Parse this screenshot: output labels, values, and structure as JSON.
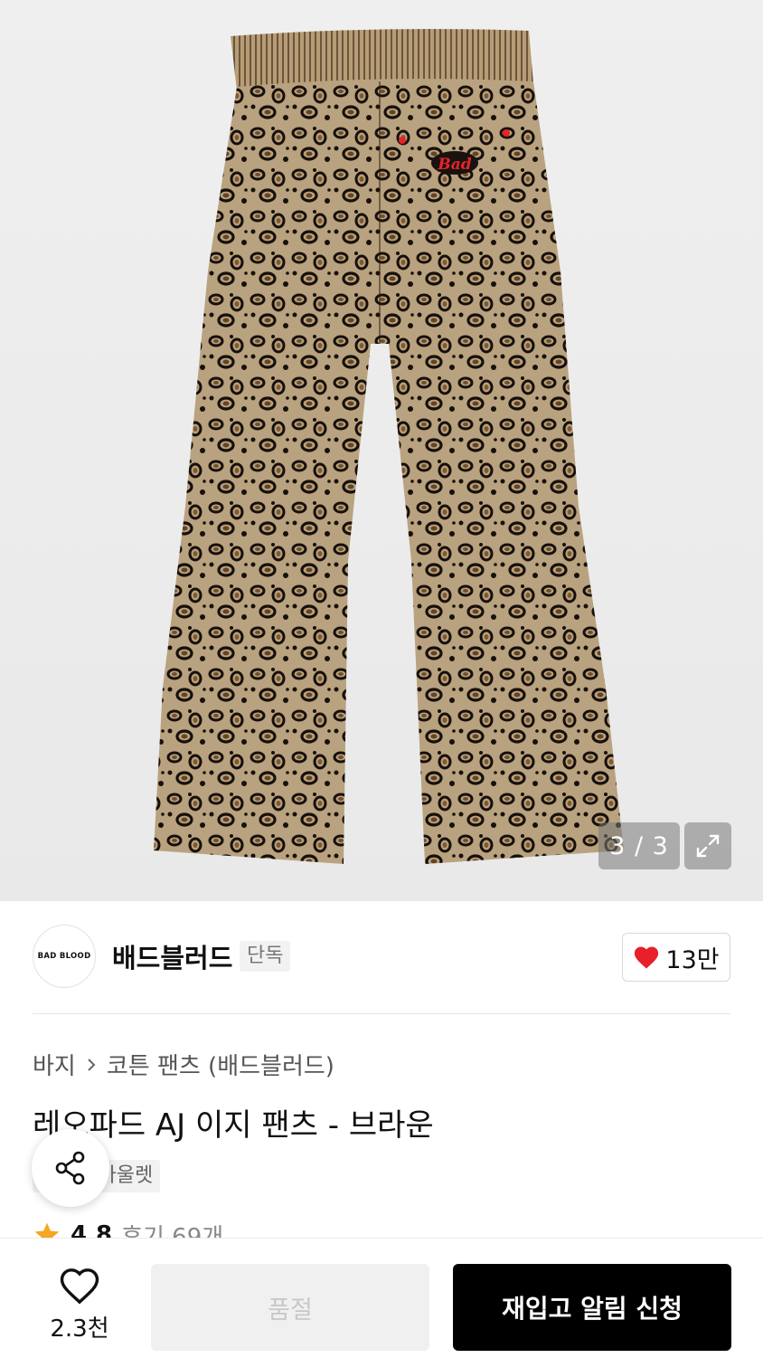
{
  "gallery": {
    "counter": "3 / 3",
    "image_alt": "leopard-print-pants-back-view",
    "pocket_patch_text": "Bad"
  },
  "brand": {
    "logo_text": "BAD BLOOD",
    "name": "배드블러드",
    "badge": "단독",
    "likes": "13만"
  },
  "breadcrumb": {
    "category": "바지",
    "subcategory": "코튼 팬츠 (배드블러드)"
  },
  "product": {
    "title": "레오파드 AJ 이지 팬츠 - 브라운",
    "tags": [
      "단독",
      "아울렛"
    ],
    "rating": "4.8",
    "review_label": "후기 69개"
  },
  "bottom": {
    "wish_count": "2.3천",
    "soldout_label": "품절",
    "restock_label": "재입고 알림 신청"
  },
  "colors": {
    "heart": "#e8202a",
    "star": "#f5a623",
    "primary_button": "#000000"
  }
}
